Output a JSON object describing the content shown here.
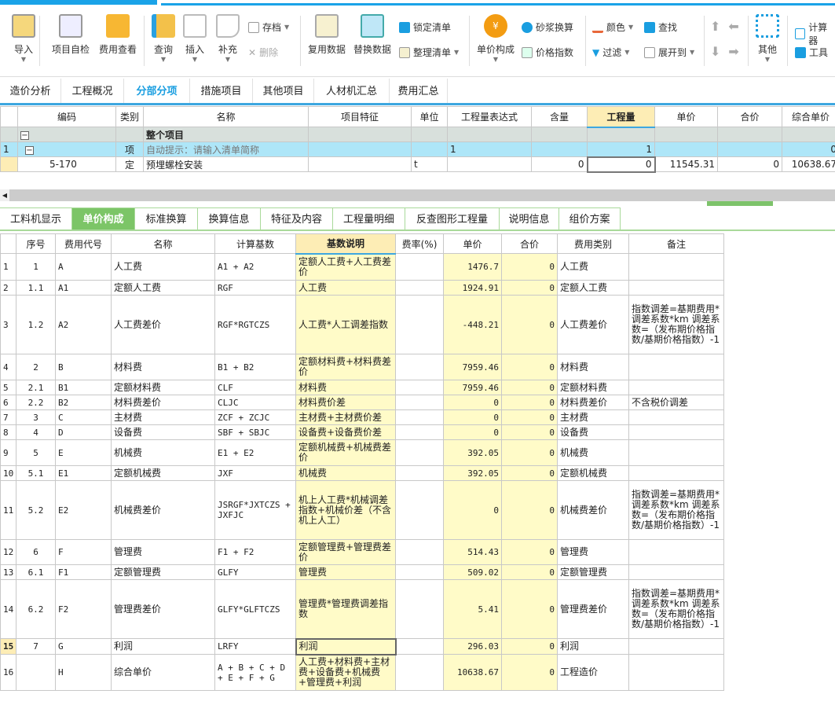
{
  "ribbon": {
    "big": [
      {
        "label": "导入",
        "icon": "import-icon"
      },
      {
        "label": "项目自检",
        "icon": "project-check-icon"
      },
      {
        "label": "费用查看",
        "icon": "cost-view-icon"
      },
      {
        "label": "查询",
        "icon": "query-icon"
      },
      {
        "label": "插入",
        "icon": "insert-icon"
      },
      {
        "label": "补充",
        "icon": "supplement-icon"
      },
      {
        "label": "复用数据",
        "icon": "reuse-data-icon"
      },
      {
        "label": "替换数据",
        "icon": "replace-data-icon"
      },
      {
        "label": "单价构成",
        "icon": "unit-price-icon"
      },
      {
        "label": "其他",
        "icon": "grid-icon"
      }
    ],
    "small": {
      "archive": "存档",
      "delete": "删除",
      "lock": "锁定清单",
      "organize": "整理清单",
      "mortar": "砂浆换算",
      "price_index": "价格指数",
      "color": "颜色",
      "filter": "过滤",
      "find": "查找",
      "expand": "展开到",
      "calculator": "计算器",
      "tools": "工具"
    }
  },
  "main_tabs": [
    "造价分析",
    "工程概况",
    "分部分项",
    "措施项目",
    "其他项目",
    "人材机汇总",
    "费用汇总"
  ],
  "main_tab_active": 2,
  "top_table": {
    "headers": [
      "",
      "编码",
      "类别",
      "名称",
      "项目特征",
      "单位",
      "工程量表达式",
      "含量",
      "工程量",
      "单价",
      "合价",
      "综合单价"
    ],
    "rows": [
      [
        "",
        "",
        "",
        "整个项目",
        "",
        "",
        "",
        "",
        "",
        "",
        "",
        ""
      ],
      [
        "1",
        "",
        "项",
        "自动提示：请输入清单简称",
        "",
        "",
        "1",
        "",
        "1",
        "",
        "",
        "0"
      ],
      [
        "",
        "5-170",
        "定",
        "预埋螺栓安装",
        "",
        "t",
        "",
        "0",
        "0",
        "11545.31",
        "0",
        "10638.67"
      ]
    ]
  },
  "sub_tabs": [
    "工料机显示",
    "单价构成",
    "标准换算",
    "换算信息",
    "特征及内容",
    "工程量明细",
    "反查图形工程量",
    "说明信息",
    "组价方案"
  ],
  "sub_tab_active": 1,
  "fee_table": {
    "headers": [
      "",
      "序号",
      "费用代号",
      "名称",
      "计算基数",
      "基数说明",
      "费率(%)",
      "单价",
      "合价",
      "费用类别",
      "备注"
    ],
    "rows": [
      [
        "1",
        "1",
        "A",
        "人工费",
        "A1 + A2",
        "定额人工费+人工费差价",
        "",
        "1476.7",
        "0",
        "人工费",
        ""
      ],
      [
        "2",
        "1.1",
        "A1",
        "定额人工费",
        "RGF",
        "人工费",
        "",
        "1924.91",
        "0",
        "定额人工费",
        ""
      ],
      [
        "3",
        "1.2",
        "A2",
        "人工费差价",
        "RGF*RGTCZS",
        "人工费*人工调差指数",
        "",
        "-448.21",
        "0",
        "人工费差价",
        "指数调差=基期费用*调差系数*km 调差系数=（发布期价格指数/基期价格指数）-1"
      ],
      [
        "4",
        "2",
        "B",
        "材料费",
        "B1 + B2",
        "定额材料费+材料费差价",
        "",
        "7959.46",
        "0",
        "材料费",
        ""
      ],
      [
        "5",
        "2.1",
        "B1",
        "定额材料费",
        "CLF",
        "材料费",
        "",
        "7959.46",
        "0",
        "定额材料费",
        ""
      ],
      [
        "6",
        "2.2",
        "B2",
        "材料费差价",
        "CLJC",
        "材料费价差",
        "",
        "0",
        "0",
        "材料费差价",
        "不含税价调差"
      ],
      [
        "7",
        "3",
        "C",
        "主材费",
        "ZCF + ZCJC",
        "主材费+主材费价差",
        "",
        "0",
        "0",
        "主材费",
        ""
      ],
      [
        "8",
        "4",
        "D",
        "设备费",
        "SBF + SBJC",
        "设备费+设备费价差",
        "",
        "0",
        "0",
        "设备费",
        ""
      ],
      [
        "9",
        "5",
        "E",
        "机械费",
        "E1 + E2",
        "定额机械费+机械费差价",
        "",
        "392.05",
        "0",
        "机械费",
        ""
      ],
      [
        "10",
        "5.1",
        "E1",
        "定额机械费",
        "JXF",
        "机械费",
        "",
        "392.05",
        "0",
        "定额机械费",
        ""
      ],
      [
        "11",
        "5.2",
        "E2",
        "机械费差价",
        "JSRGF*JXTCZS + JXFJC",
        "机上人工费*机械调差指数+机械价差（不含机上人工）",
        "",
        "0",
        "0",
        "机械费差价",
        "指数调差=基期费用*调差系数*km 调差系数=（发布期价格指数/基期价格指数）-1"
      ],
      [
        "12",
        "6",
        "F",
        "管理费",
        "F1 + F2",
        "定额管理费+管理费差价",
        "",
        "514.43",
        "0",
        "管理费",
        ""
      ],
      [
        "13",
        "6.1",
        "F1",
        "定额管理费",
        "GLFY",
        "管理费",
        "",
        "509.02",
        "0",
        "定额管理费",
        ""
      ],
      [
        "14",
        "6.2",
        "F2",
        "管理费差价",
        "GLFY*GLFTCZS",
        "管理费*管理费调差指数",
        "",
        "5.41",
        "0",
        "管理费差价",
        "指数调差=基期费用*调差系数*km 调差系数=（发布期价格指数/基期价格指数）-1"
      ],
      [
        "15",
        "7",
        "G",
        "利润",
        "LRFY",
        "利润",
        "",
        "296.03",
        "0",
        "利润",
        ""
      ],
      [
        "16",
        "",
        "H",
        "综合单价",
        "A + B + C + D + E + F + G",
        "人工费+材料费+主材费+设备费+机械费+管理费+利润",
        "",
        "10638.67",
        "0",
        "工程造价",
        ""
      ]
    ]
  },
  "colors": {
    "accent": "#1aa3e8",
    "active_subtab": "#7cc567",
    "highlight": "#fdedb5",
    "selected_row": "#aee6f8",
    "group_row": "#d8e0dc",
    "yellow_cell": "#fffbc8"
  }
}
